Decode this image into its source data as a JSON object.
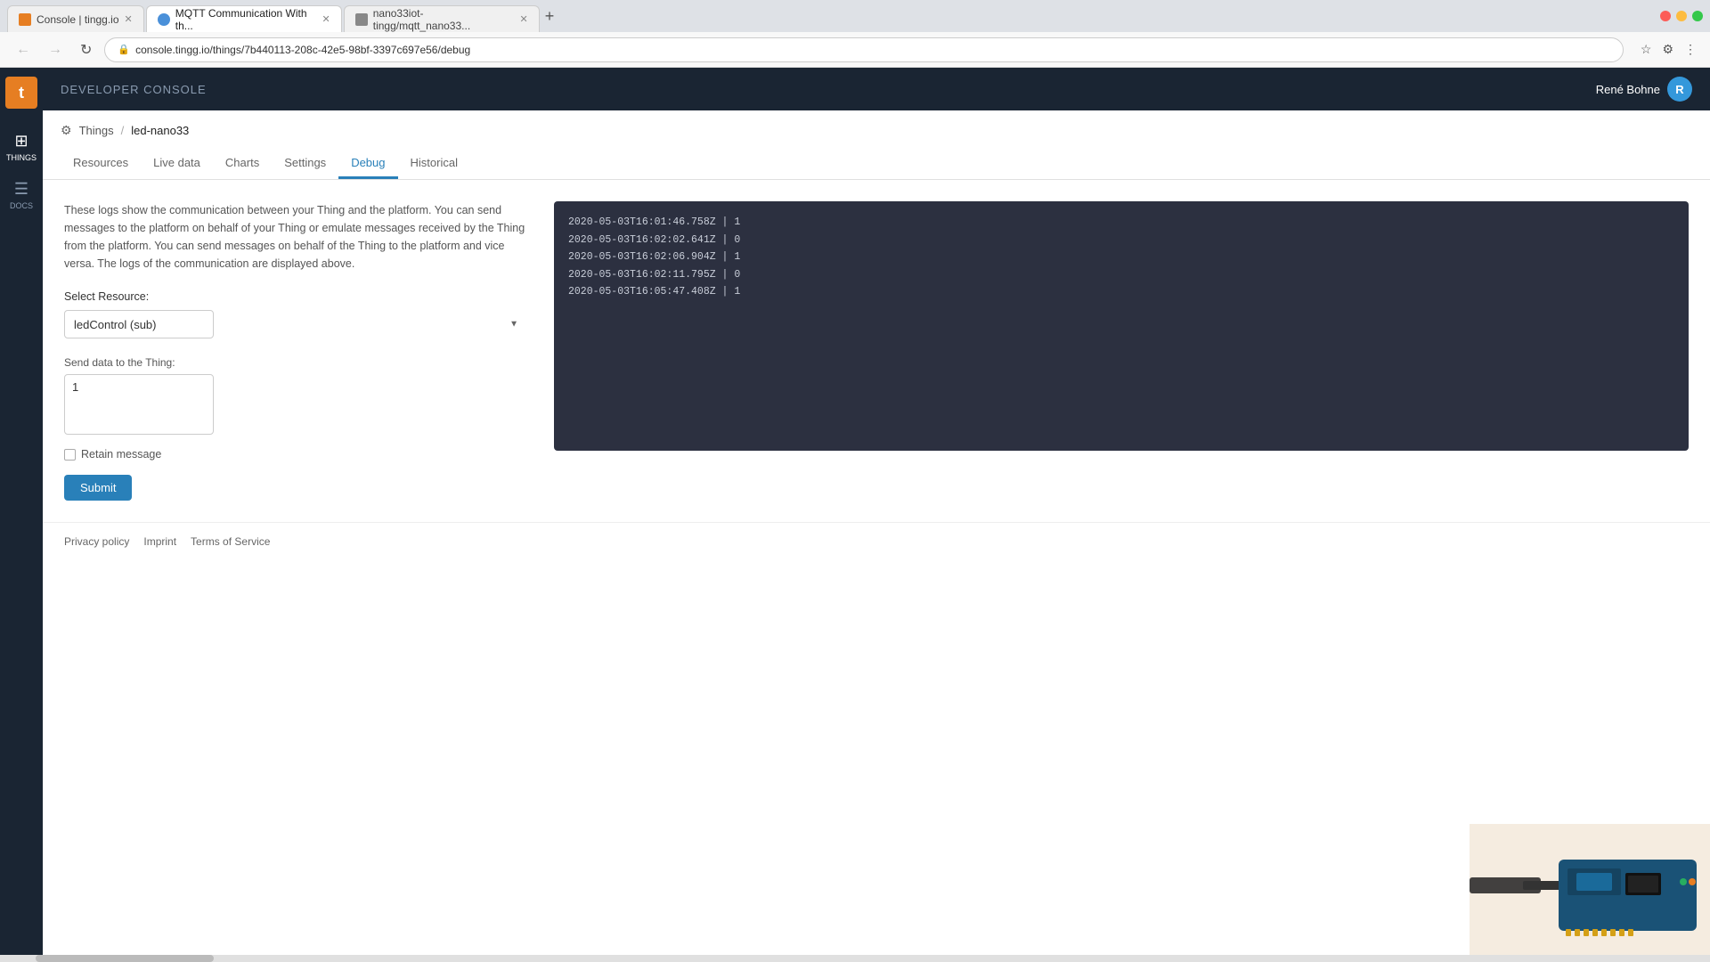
{
  "browser": {
    "tabs": [
      {
        "id": "tab1",
        "title": "Console | tingg.io",
        "favicon": "t",
        "active": false
      },
      {
        "id": "tab2",
        "title": "MQTT Communication With th...",
        "favicon": "m",
        "active": true
      },
      {
        "id": "tab3",
        "title": "nano33iot-tingg/mqtt_nano33...",
        "favicon": "n",
        "active": false
      }
    ],
    "address": "console.tingg.io/things/7b440113-208c-42e5-98bf-3397c697e56/debug",
    "new_tab_label": "+"
  },
  "topbar": {
    "brand": "DEVELOPER CONSOLE",
    "user": "René Bohne"
  },
  "sidebar": {
    "logo": "t",
    "items": [
      {
        "id": "things",
        "label": "THINGS",
        "icon": "⊞"
      },
      {
        "id": "docs",
        "label": "DOCS",
        "icon": "≡"
      }
    ]
  },
  "thing": {
    "breadcrumb_things": "Things",
    "name": "led-nano33",
    "tabs": [
      {
        "id": "resources",
        "label": "Resources",
        "active": false
      },
      {
        "id": "livedata",
        "label": "Live data",
        "active": false
      },
      {
        "id": "charts",
        "label": "Charts",
        "active": false
      },
      {
        "id": "settings",
        "label": "Settings",
        "active": false
      },
      {
        "id": "debug",
        "label": "Debug",
        "active": true
      },
      {
        "id": "historical",
        "label": "Historical",
        "active": false
      }
    ]
  },
  "debug": {
    "info_text": "These logs show the communication between your Thing and the platform. You can send messages to the platform on behalf of your Thing or emulate messages received by the Thing from the platform. You can send messages on behalf of the Thing to the platform and vice versa. The logs of the communication are displayed above.",
    "select_resource_label": "Select Resource:",
    "resource_options": [
      {
        "value": "ledControl_sub",
        "label": "ledControl (sub)"
      }
    ],
    "selected_resource": "ledControl (sub)",
    "send_data_label": "Send data to the Thing:",
    "message_value": "1",
    "retain_label": "Retain message",
    "submit_label": "Submit",
    "log_lines": [
      "2020-05-03T16:01:46.758Z | 1",
      "2020-05-03T16:02:02.641Z | 0",
      "2020-05-03T16:02:06.904Z | 1",
      "2020-05-03T16:02:11.795Z | 0",
      "2020-05-03T16:05:47.408Z | 1"
    ]
  },
  "footer": {
    "links": [
      {
        "label": "Privacy policy"
      },
      {
        "label": "Imprint"
      },
      {
        "label": "Terms of Service"
      }
    ]
  }
}
